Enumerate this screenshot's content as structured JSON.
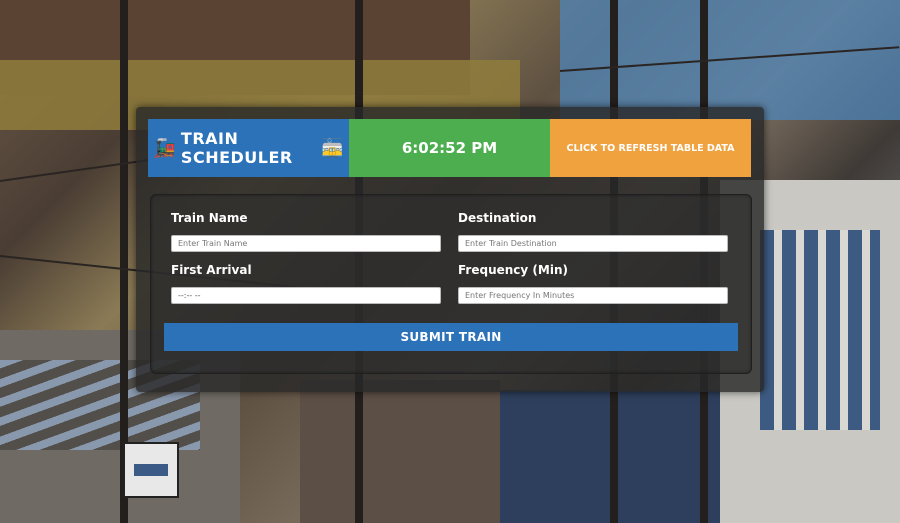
{
  "header": {
    "title": "TRAIN SCHEDULER",
    "title_icon_left": "steam-locomotive",
    "title_icon_right": "tram-car",
    "clock": "6:02:52 PM",
    "refresh_label": "CLICK TO REFRESH TABLE DATA",
    "colors": {
      "title_bg": "#2b72b8",
      "clock_bg": "#4cae4f",
      "refresh_bg": "#efa23e"
    }
  },
  "form": {
    "train_name": {
      "label": "Train Name",
      "placeholder": "Enter Train Name"
    },
    "destination": {
      "label": "Destination",
      "placeholder": "Enter Train Destination"
    },
    "first_arrival": {
      "label": "First Arrival",
      "value": "--:-- --"
    },
    "frequency": {
      "label": "Frequency (Min)",
      "placeholder": "Enter Frequency In Minutes"
    },
    "submit_label": "SUBMIT TRAIN",
    "submit_color": "#2b72b8"
  }
}
